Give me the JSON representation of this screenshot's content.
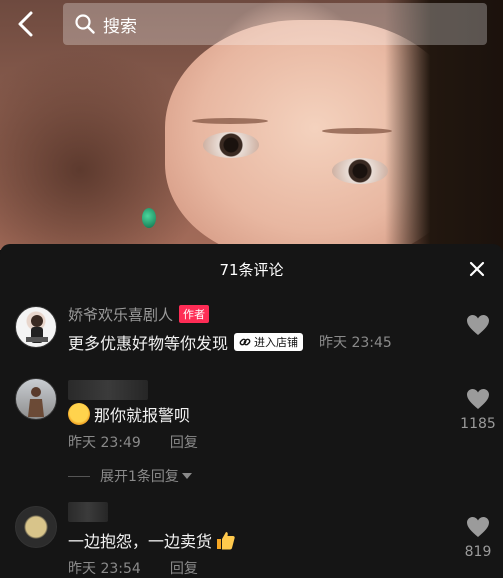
{
  "search": {
    "placeholder": "搜索"
  },
  "comments_panel": {
    "title": "71条评论",
    "comments": [
      {
        "username": "娇爷欢乐喜剧人",
        "author_tag": "作者",
        "text": "更多优惠好物等你发现",
        "shop_badge": "进入店铺",
        "time": "昨天 23:45",
        "like_count": ""
      },
      {
        "username": "",
        "text": "那你就报警呗",
        "time": "昨天 23:49",
        "reply_label": "回复",
        "like_count": "1185",
        "expand_label": "展开1条回复"
      },
      {
        "username": "",
        "text": "一边抱怨，一边卖货",
        "time": "昨天 23:54",
        "reply_label": "回复",
        "like_count": "819"
      }
    ]
  },
  "icons": {
    "back": "chevron-left-icon",
    "search": "search-icon",
    "close": "close-icon",
    "like": "heart-icon",
    "link": "link-icon",
    "expand": "caret-down-icon"
  },
  "colors": {
    "panel_bg": "#151515",
    "author_tag": "#fe2c55",
    "muted_text": "#8a8a8a"
  }
}
